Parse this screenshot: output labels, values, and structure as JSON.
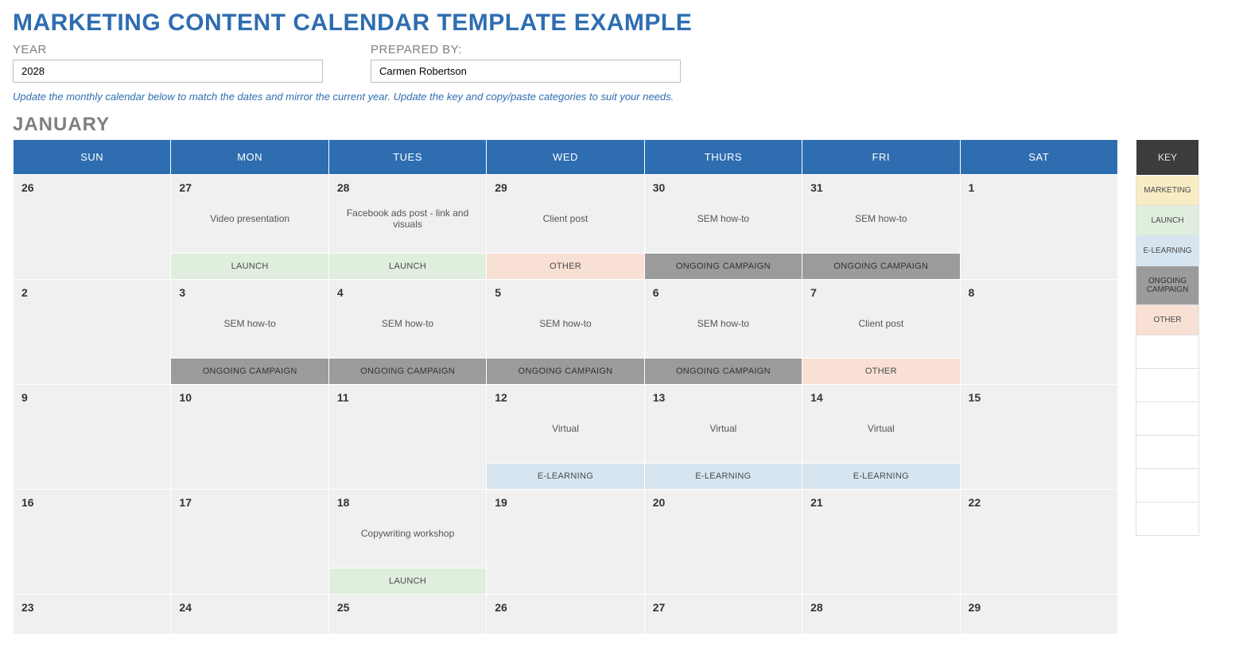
{
  "title": "MARKETING CONTENT CALENDAR TEMPLATE EXAMPLE",
  "meta": {
    "year_label": "YEAR",
    "year_value": "2028",
    "prepared_label": "PREPARED BY:",
    "prepared_value": "Carmen Robertson"
  },
  "instructions": "Update the monthly calendar below to match the dates and mirror the current year. Update the key and copy/paste categories to suit your needs.",
  "month": "JANUARY",
  "day_headers": [
    "SUN",
    "MON",
    "TUES",
    "WED",
    "THURS",
    "FRI",
    "SAT"
  ],
  "weeks": [
    [
      {
        "num": "26"
      },
      {
        "num": "27",
        "event": "Video presentation",
        "cat": "LAUNCH",
        "cls": "cat-launch"
      },
      {
        "num": "28",
        "event": "Facebook ads post - link and visuals",
        "cat": "LAUNCH",
        "cls": "cat-launch"
      },
      {
        "num": "29",
        "event": "Client post",
        "cat": "OTHER",
        "cls": "cat-other"
      },
      {
        "num": "30",
        "event": "SEM how-to",
        "cat": "ONGOING CAMPAIGN",
        "cls": "cat-ongoing"
      },
      {
        "num": "31",
        "event": "SEM how-to",
        "cat": "ONGOING CAMPAIGN",
        "cls": "cat-ongoing"
      },
      {
        "num": "1"
      }
    ],
    [
      {
        "num": "2"
      },
      {
        "num": "3",
        "event": "SEM how-to",
        "cat": "ONGOING CAMPAIGN",
        "cls": "cat-ongoing"
      },
      {
        "num": "4",
        "event": "SEM how-to",
        "cat": "ONGOING CAMPAIGN",
        "cls": "cat-ongoing"
      },
      {
        "num": "5",
        "event": "SEM how-to",
        "cat": "ONGOING CAMPAIGN",
        "cls": "cat-ongoing"
      },
      {
        "num": "6",
        "event": "SEM how-to",
        "cat": "ONGOING CAMPAIGN",
        "cls": "cat-ongoing"
      },
      {
        "num": "7",
        "event": "Client post",
        "cat": "OTHER",
        "cls": "cat-other"
      },
      {
        "num": "8"
      }
    ],
    [
      {
        "num": "9"
      },
      {
        "num": "10"
      },
      {
        "num": "11"
      },
      {
        "num": "12",
        "event": "Virtual",
        "cat": "E-LEARNING",
        "cls": "cat-elearn"
      },
      {
        "num": "13",
        "event": "Virtual",
        "cat": "E-LEARNING",
        "cls": "cat-elearn"
      },
      {
        "num": "14",
        "event": "Virtual",
        "cat": "E-LEARNING",
        "cls": "cat-elearn"
      },
      {
        "num": "15"
      }
    ],
    [
      {
        "num": "16"
      },
      {
        "num": "17"
      },
      {
        "num": "18",
        "event": "Copywriting workshop",
        "cat": "LAUNCH",
        "cls": "cat-launch"
      },
      {
        "num": "19"
      },
      {
        "num": "20"
      },
      {
        "num": "21"
      },
      {
        "num": "22"
      }
    ],
    [
      {
        "num": "23"
      },
      {
        "num": "24"
      },
      {
        "num": "25"
      },
      {
        "num": "26"
      },
      {
        "num": "27"
      },
      {
        "num": "28"
      },
      {
        "num": "29"
      }
    ]
  ],
  "key": {
    "header": "KEY",
    "items": [
      {
        "label": "MARKETING",
        "cls": "cat-marketing"
      },
      {
        "label": "LAUNCH",
        "cls": "cat-launch"
      },
      {
        "label": "E-LEARNING",
        "cls": "cat-elearn"
      },
      {
        "label": "ONGOING CAMPAIGN",
        "cls": "cat-ongoing"
      },
      {
        "label": "OTHER",
        "cls": "cat-other"
      }
    ],
    "empty_rows": 6
  }
}
